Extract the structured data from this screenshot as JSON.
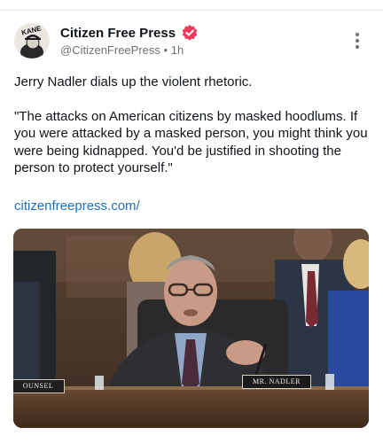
{
  "post": {
    "author": {
      "display_name": "Citizen Free Press",
      "handle": "@CitizenFreePress",
      "separator": "•",
      "time": "1h",
      "avatar_text": "KANE",
      "verified_color": "#f0375c"
    },
    "text_line1": "Jerry Nadler dials up the violent rhetoric.",
    "text_quote": "\"The attacks on American citizens by masked hoodlums. If you were attacked by a masked person, you might think you were being kidnapped. You'd be justified in shooting the person to protect yourself.\"",
    "link": "citizenfreepress.com/",
    "media": {
      "nameplate": "MR. NADLER",
      "counsel_plate": "OUNSEL"
    }
  },
  "colors": {
    "link": "#1f6fb7",
    "handle": "#6b7177"
  },
  "icons": {
    "more": "more-vertical-icon",
    "verified": "verified-badge-icon"
  }
}
